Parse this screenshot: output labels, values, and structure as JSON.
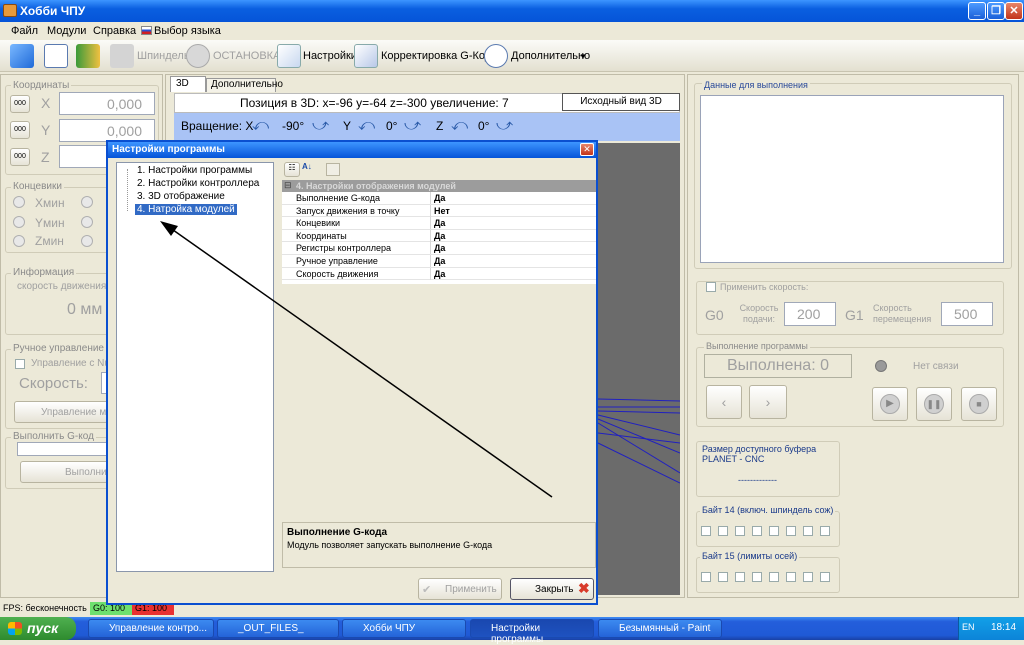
{
  "window": {
    "title": "Хобби ЧПУ",
    "btn_min": "_",
    "btn_max": "❐",
    "btn_close": "✕"
  },
  "menu": [
    "Файл",
    "Модули",
    "Справка",
    "Выбор языка"
  ],
  "toolbar": {
    "spindle": "Шпиндель",
    "stop": "ОСТАНОВКА",
    "settings": "Настройки",
    "gcode_edit": "Корректировка G-Кода",
    "extra": "Дополнительно"
  },
  "coords": {
    "group": "Координаты",
    "x_label": "X",
    "y_label": "Y",
    "z_label": "Z",
    "x_value": "0,000",
    "y_value": "0,000",
    "btn": "000"
  },
  "limits": {
    "group": "Концевики",
    "x": "Xмин",
    "y": "Yмин",
    "z": "Zмин"
  },
  "info": {
    "group": "Информация",
    "speed_label": "скорость движения",
    "speed_value": "0 мм"
  },
  "manual": {
    "group": "Ручное управление",
    "checkbox": "Управление с Num",
    "speed": "Скорость:",
    "btn": "Управление мы"
  },
  "execute": {
    "group": "Выполнить G-код",
    "btn": "Выполни"
  },
  "view3d": {
    "tab_3d": "3D",
    "tab_extra": "Дополнительно",
    "position": "Позиция в 3D: x=-96 y=-64 z=-300 увеличение: 7",
    "reset_btn": "Исходный вид 3D",
    "rotation": "Вращение: X",
    "x_angle": "-90°",
    "y_label": "Y",
    "y_angle": "0°",
    "z_label": "Z",
    "z_angle": "0°"
  },
  "right": {
    "data_group": "Данные для выполнения",
    "apply_speed": "Применить скорость:",
    "g0": "G0",
    "feed_label": "Скорость подачи:",
    "feed_value": "200",
    "g1": "G1",
    "move_label": "Скорость перемещения",
    "move_value": "500",
    "exec_group": "Выполнение программы",
    "done": "Выполнена: 0",
    "noconn": "Нет связи",
    "prev": "‹",
    "next": "›",
    "buffer_title": "Размер доступного буфера",
    "buffer_device": "PLANET - CNC",
    "buffer_value": "-------------",
    "byte14": "Байт 14 (включ. шпиндель сож)",
    "byte15": "Байт 15 (лимиты осей)"
  },
  "dialog": {
    "title": "Настройки программы",
    "close": "✕",
    "tree": [
      "1. Настройки программы",
      "2. Настройки контроллера",
      "3. 3D отображение",
      "4. Натройка модулей"
    ],
    "section": "4. Настройки отображения модулей",
    "rows": [
      {
        "name": "Выполнение G-кода",
        "value": "Да"
      },
      {
        "name": "Запуск движения в точку",
        "value": "Нет"
      },
      {
        "name": "Концевики",
        "value": "Да"
      },
      {
        "name": "Координаты",
        "value": "Да"
      },
      {
        "name": "Регистры контроллера",
        "value": "Да"
      },
      {
        "name": "Ручное управление",
        "value": "Да"
      },
      {
        "name": "Скорость движения",
        "value": "Да"
      }
    ],
    "desc_title": "Выполнение G-кода",
    "desc_text": "Модуль позволяет запускать выполнение G-кода",
    "apply": "Применить",
    "close_btn": "Закрыть"
  },
  "status": {
    "fps": "FPS: бесконечность",
    "g0": "G0: 100",
    "g1": "G1: 100"
  },
  "taskbar": {
    "start": "пуск",
    "tasks": [
      "Управление контро...",
      "_OUT_FILES_",
      "Хобби ЧПУ",
      "Настройки программы",
      "Безымянный - Paint"
    ],
    "time": "18:14",
    "lang": "EN"
  }
}
